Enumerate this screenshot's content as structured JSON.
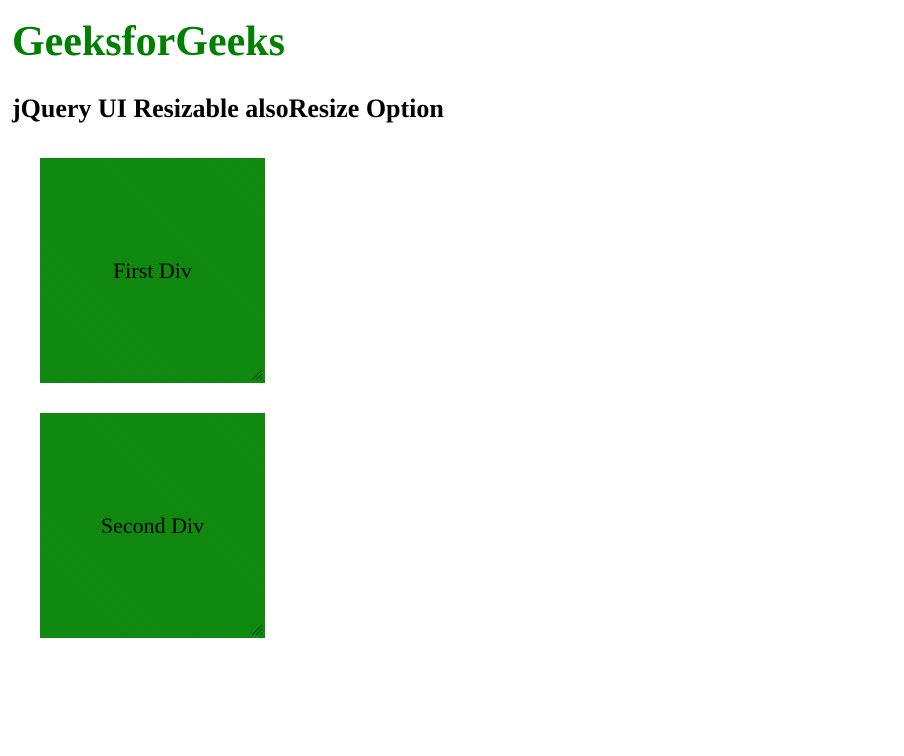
{
  "header": {
    "title": "GeeksforGeeks",
    "subtitle": "jQuery UI Resizable alsoResize Option"
  },
  "boxes": {
    "first": {
      "label": "First Div"
    },
    "second": {
      "label": "Second Div"
    }
  },
  "colors": {
    "brand_green": "#008000",
    "box_green": "#0f8a0f"
  }
}
